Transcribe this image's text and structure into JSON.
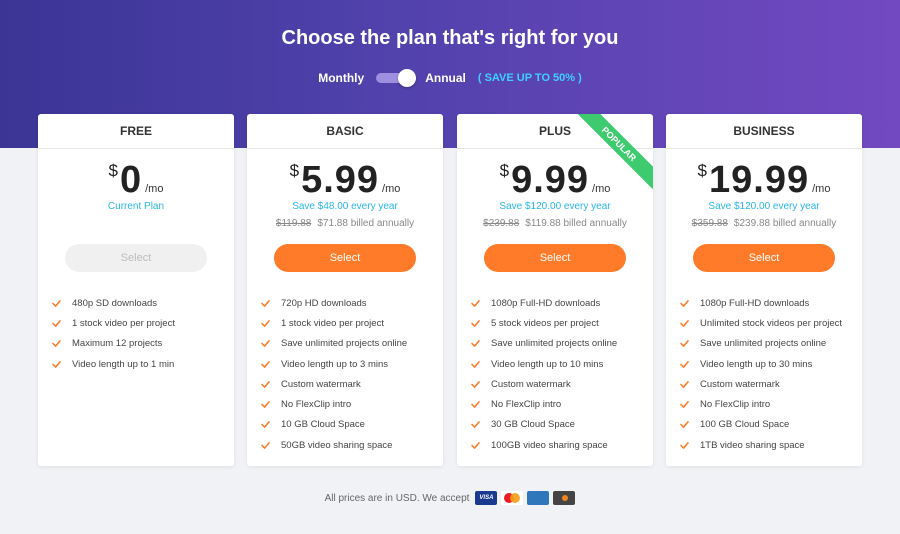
{
  "header": {
    "title": "Choose the plan that's right for you",
    "toggle": {
      "left_label": "Monthly",
      "right_label": "Annual",
      "selected": "Annual",
      "save_tag": "( SAVE UP TO 50% )"
    }
  },
  "colors": {
    "accent": "#ff7b29",
    "save_text": "#2bb5e8",
    "popular": "#3ecb6f",
    "hero_start": "#3b3596",
    "hero_end": "#7249c0"
  },
  "plans": [
    {
      "name": "FREE",
      "currency": "$",
      "price": "0",
      "period": "/mo",
      "subtitle": "Current Plan",
      "old_price": "",
      "billed": "",
      "button": "Select",
      "button_enabled": false,
      "features": [
        "480p SD downloads",
        "1 stock video per project",
        "Maximum 12 projects",
        "Video length up to 1 min"
      ]
    },
    {
      "name": "BASIC",
      "currency": "$",
      "price": "5.99",
      "period": "/mo",
      "subtitle": "Save $48.00 every year",
      "old_price": "$119.88",
      "billed": "$71.88 billed annually",
      "button": "Select",
      "button_enabled": true,
      "features": [
        "720p HD downloads",
        "1 stock video per project",
        "Save unlimited projects online",
        "Video length up to 3 mins",
        "Custom watermark",
        "No FlexClip intro",
        "10 GB Cloud Space",
        "50GB video sharing space"
      ]
    },
    {
      "name": "PLUS",
      "currency": "$",
      "price": "9.99",
      "period": "/mo",
      "badge": "POPULAR",
      "subtitle": "Save $120.00 every year",
      "old_price": "$239.88",
      "billed": "$119.88 billed annually",
      "button": "Select",
      "button_enabled": true,
      "features": [
        "1080p Full-HD downloads",
        "5 stock videos per project",
        "Save unlimited projects online",
        "Video length up to 10 mins",
        "Custom watermark",
        "No FlexClip intro",
        "30 GB Cloud Space",
        "100GB video sharing space"
      ]
    },
    {
      "name": "BUSINESS",
      "currency": "$",
      "price": "19.99",
      "period": "/mo",
      "subtitle": "Save $120.00 every year",
      "old_price": "$359.88",
      "billed": "$239.88 billed annually",
      "button": "Select",
      "button_enabled": true,
      "features": [
        "1080p Full-HD downloads",
        "Unlimited stock videos per project",
        "Save unlimited projects online",
        "Video length up to 30 mins",
        "Custom watermark",
        "No FlexClip intro",
        "100 GB Cloud Space",
        "1TB video sharing space"
      ]
    }
  ],
  "footer": {
    "text": "All prices are in USD. We accept",
    "payment_icons": [
      "visa-icon",
      "mastercard-icon",
      "amex-icon",
      "discover-icon"
    ],
    "visa_label": "VISA"
  }
}
